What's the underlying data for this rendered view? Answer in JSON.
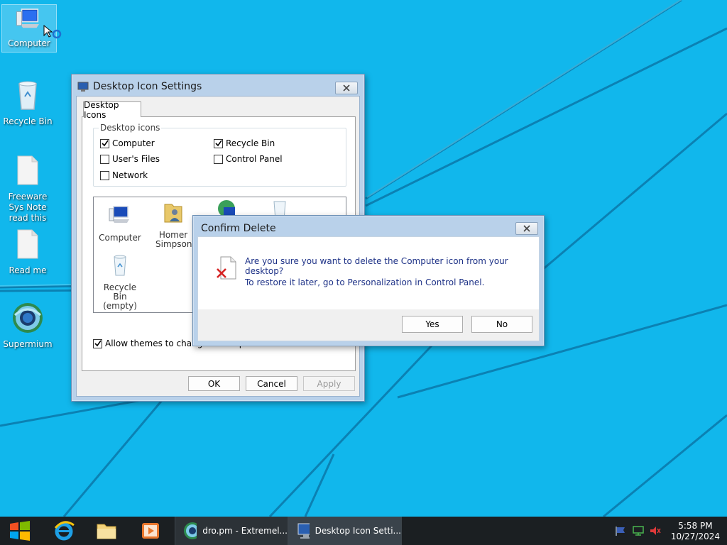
{
  "desktop": {
    "icons": [
      {
        "label": "Computer"
      },
      {
        "label": "Recycle Bin"
      },
      {
        "label": "Freeware Sys Note read this"
      },
      {
        "label": "Read me"
      },
      {
        "label": "Supermium"
      }
    ],
    "colors": {
      "background": "#11b7ec"
    }
  },
  "dialog_settings": {
    "title": "Desktop Icon Settings",
    "tab": "Desktop Icons",
    "group_label": "Desktop icons",
    "checkboxes": [
      {
        "label": "Computer",
        "checked": true
      },
      {
        "label": "Recycle Bin",
        "checked": true
      },
      {
        "label": "User's Files",
        "checked": false
      },
      {
        "label": "Control Panel",
        "checked": false
      },
      {
        "label": "Network",
        "checked": false
      }
    ],
    "preview_icons": [
      {
        "label": "Computer"
      },
      {
        "label": "Homer Simpson"
      },
      {
        "label": "Recycle Bin (empty)"
      }
    ],
    "allow_themes_label": "Allow themes to change desktop icons",
    "allow_themes_checked": true,
    "ok_label": "OK",
    "cancel_label": "Cancel",
    "apply_label": "Apply"
  },
  "dialog_confirm": {
    "title": "Confirm Delete",
    "message": "Are you sure you want to delete the Computer icon from your desktop?",
    "hint": "To restore it later, go to Personalization in Control Panel.",
    "yes_label": "Yes",
    "no_label": "No"
  },
  "taskbar": {
    "tasks": [
      {
        "label": "dro.pm - Extremel..."
      },
      {
        "label": "Desktop Icon Setti..."
      }
    ],
    "time": "5:58 PM",
    "date": "10/27/2024",
    "colors": {
      "background": "#1b1f22"
    }
  }
}
